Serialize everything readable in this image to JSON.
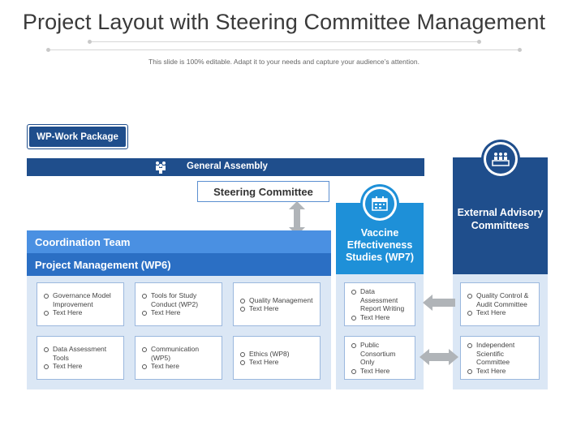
{
  "title": "Project Layout with Steering Committee Management",
  "subtitle": "This slide is 100% editable. Adapt it to your needs and capture your audience’s attention.",
  "wp_badge": "WP-Work Package",
  "general_assembly": {
    "label": "General Assembly",
    "icon": "group-icon"
  },
  "steering_committee": "Steering Committee",
  "coordination_team": "Coordination Team",
  "project_management": "Project Management (WP6)",
  "wp6_cards": [
    {
      "lines": [
        "Governance Model Improvement",
        "Text Here"
      ]
    },
    {
      "lines": [
        "Tools for Study Conduct (WP2)",
        "Text Here"
      ]
    },
    {
      "lines": [
        "Quality Management",
        "Text Here"
      ]
    },
    {
      "lines": [
        "Data Assessment Tools",
        "Text Here"
      ]
    },
    {
      "lines": [
        "Communication (WP5)",
        "Text here"
      ]
    },
    {
      "lines": [
        "Ethics (WP8)",
        "Text Here"
      ]
    }
  ],
  "vaccine": {
    "title": "Vaccine Effectiveness Studies (WP7)",
    "icon": "calendar-icon",
    "cards": [
      {
        "lines": [
          "Data Assessment Report Writing",
          "Text Here"
        ]
      },
      {
        "lines": [
          "Public Consortium Only",
          "Text Here"
        ]
      }
    ]
  },
  "external": {
    "title": "External Advisory Committees",
    "icon": "committee-icon",
    "cards": [
      {
        "lines": [
          "Quality Control & Audit Committee",
          "Text Here"
        ]
      },
      {
        "lines": [
          "Independent Scientific Committee",
          "Text Here"
        ]
      }
    ]
  },
  "colors": {
    "navy": "#1f4e8c",
    "blue": "#2b6fc4",
    "light_blue": "#4a90e2",
    "sky": "#1e90d8",
    "panel": "#dbe7f5",
    "arrow": "#b0b4b8"
  }
}
